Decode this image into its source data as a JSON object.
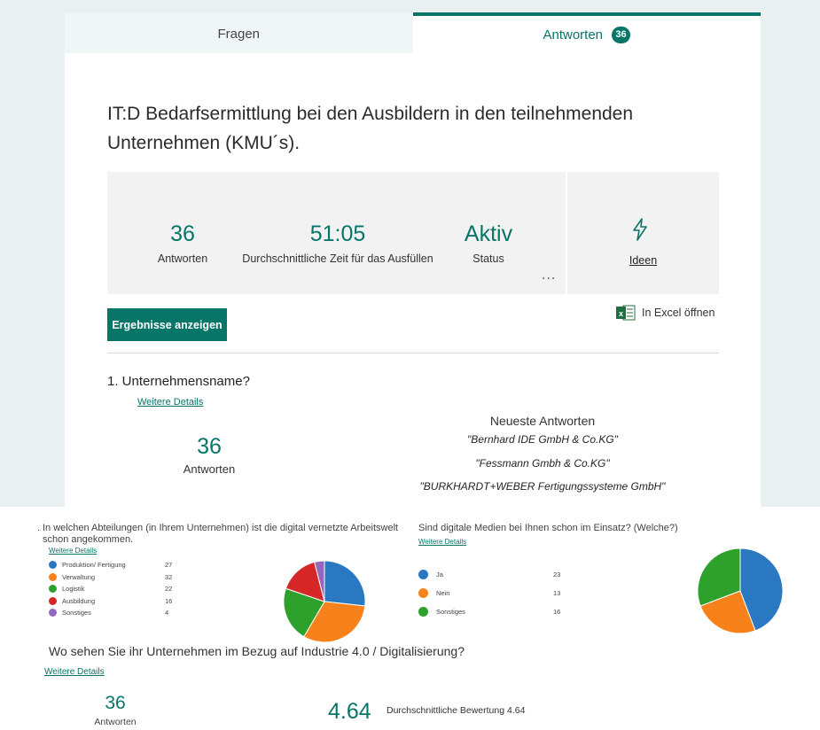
{
  "tabs": {
    "fragen": "Fragen",
    "antworten": "Antworten",
    "antworten_badge": "36"
  },
  "form": {
    "title": "IT:D Bedarfsermittlung bei den Ausbildern in den teilnehmenden Unternehmen (KMU´s)."
  },
  "summary": {
    "responses_value": "36",
    "responses_label": "Antworten",
    "avg_time_value": "51:05",
    "avg_time_label": "Durchschnittliche Zeit für das Ausfüllen",
    "status_value": "Aktiv",
    "status_label": "Status",
    "more": "...",
    "ideas_label": "Ideen",
    "ideas_icon": "lightning-bolt-icon"
  },
  "actions": {
    "view_results": "Ergebnisse anzeigen",
    "open_excel": "In Excel öffnen",
    "excel_icon": "excel-icon"
  },
  "colors": {
    "accent": "#077568",
    "blue": "#2a78c2",
    "orange": "#f7821b",
    "green": "#2ea02c",
    "red": "#d62728",
    "purple": "#9467bd"
  },
  "q1": {
    "title": "1. Unternehmensname?",
    "details": "Weitere Details",
    "count": "36",
    "count_label": "Antworten",
    "latest_heading": "Neueste Antworten",
    "latest": [
      "\"Bernhard IDE GmbH & Co.KG\"",
      "\"Fessmann Gmbh & Co.KG\"",
      "\"BURKHARDT+WEBER Fertigungssysteme GmbH\""
    ]
  },
  "q2": {
    "title_prefix": ".",
    "title": "In welchen Abteilungen (in Ihrem Unternehmen) ist die digital vernetzte Arbeitswelt schon angekommen.",
    "details": "Weitere Details",
    "legend": [
      {
        "label": "Produktion/ Fertigung",
        "value": "27",
        "color": "#2a78c2"
      },
      {
        "label": "Verwaltung",
        "value": "32",
        "color": "#f7821b"
      },
      {
        "label": "Logistik",
        "value": "22",
        "color": "#2ea02c"
      },
      {
        "label": "Ausbildung",
        "value": "16",
        "color": "#d62728"
      },
      {
        "label": "Sonstiges",
        "value": "4",
        "color": "#9467bd"
      }
    ]
  },
  "q3": {
    "title": "Sind digitale Medien bei Ihnen schon im Einsatz? (Welche?)",
    "details": "Weitere Details",
    "legend": [
      {
        "label": "Ja",
        "value": "23",
        "color": "#2a78c2"
      },
      {
        "label": "Nein",
        "value": "13",
        "color": "#f7821b"
      },
      {
        "label": "Sonstiges",
        "value": "16",
        "color": "#2ea02c"
      }
    ]
  },
  "q4": {
    "title": "Wo sehen Sie ihr Unternehmen im Bezug auf Industrie 4.0 / Digitalisierung?",
    "details": "Weitere Details",
    "count": "36",
    "count_label": "Antworten",
    "avg_value": "4.64",
    "avg_label": "Durchschnittliche Bewertung 4.64"
  },
  "chart_data": [
    {
      "type": "pie",
      "categories": [
        "Produktion/ Fertigung",
        "Verwaltung",
        "Logistik",
        "Ausbildung",
        "Sonstiges"
      ],
      "values": [
        27,
        32,
        22,
        16,
        4
      ],
      "colors": [
        "#2a78c2",
        "#f7821b",
        "#2ea02c",
        "#d62728",
        "#9467bd"
      ],
      "legend": "left"
    },
    {
      "type": "pie",
      "categories": [
        "Ja",
        "Nein",
        "Sonstiges"
      ],
      "values": [
        23,
        13,
        16
      ],
      "colors": [
        "#2a78c2",
        "#f7821b",
        "#2ea02c"
      ],
      "legend": "left"
    }
  ]
}
